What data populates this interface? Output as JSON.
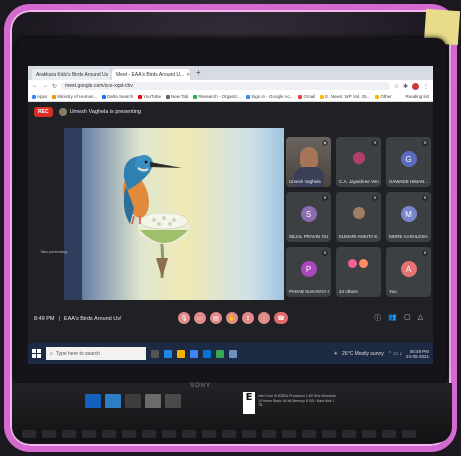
{
  "browser": {
    "tabs": [
      {
        "title": "Arakkara Kids's Birds Around Us",
        "active": false
      },
      {
        "title": "Meet - EAA's Birds Around U...",
        "active": true
      }
    ],
    "new_tab_label": "+",
    "url": "meet.google.com/zce-xqst-cbv",
    "bookmarks": [
      "Apps",
      "Ministry of Human...",
      "Delta Search",
      "YouTube",
      "New Tab",
      "Research - Organiz...",
      "Sign in - Google Ac...",
      "Gmail",
      "E. News: WP Vol. 25...",
      "Other"
    ],
    "reading_list": "Reading list"
  },
  "meet": {
    "rec_label": "REC",
    "presenting_text": "Umesh Vaghela is presenting",
    "side_label": "Tata presenting",
    "participants": [
      {
        "name": "Umesh Vaghela",
        "type": "video",
        "color": "#4a4440"
      },
      {
        "name": "C.A. Jayashree Ven...",
        "type": "photo",
        "color": "#b0406a"
      },
      {
        "name": "GAWADE HIMAN...",
        "type": "letter",
        "letter": "G",
        "color": "#5c6bc0"
      },
      {
        "name": "SEJAL PRAVIN GU...",
        "type": "letter",
        "letter": "S",
        "color": "#8a6bb0"
      },
      {
        "name": "KUMARI ANKITA E...",
        "type": "photo",
        "color": "#a07d62"
      },
      {
        "name": "MORE AASHLESH...",
        "type": "letter",
        "letter": "M",
        "color": "#7986cb"
      },
      {
        "name": "PARAB SUKANYA S...",
        "type": "letter",
        "letter": "P",
        "color": "#ab47bc"
      },
      {
        "name": "44 others",
        "type": "others",
        "color": "#3c4043"
      },
      {
        "name": "You",
        "type": "letter",
        "letter": "A",
        "color": "#e57373"
      }
    ],
    "controls": {
      "time": "8:49 PM",
      "meeting_name": "EAA's Birds Around Us!",
      "buttons": [
        "mic",
        "camera",
        "captions",
        "hand",
        "present",
        "more",
        "end"
      ]
    }
  },
  "taskbar": {
    "search_placeholder": "Type here to search",
    "weather": "26°C  Mostly sunny",
    "time": "08:49 PM",
    "date": "24-05-2021"
  },
  "laptop": {
    "brand": "SONY",
    "energy_label": "E",
    "spec_text": "Intel Core i5 8250U Processor 1.60 GHz Windows 10 Home Basic 64 bit Memory 8 GB / Hard disk 1 TB"
  },
  "colors": {
    "frame_border": "#d46ad0",
    "meet_bg": "#202124",
    "rec_red": "#d93025",
    "taskbar": "#1d2a44"
  }
}
